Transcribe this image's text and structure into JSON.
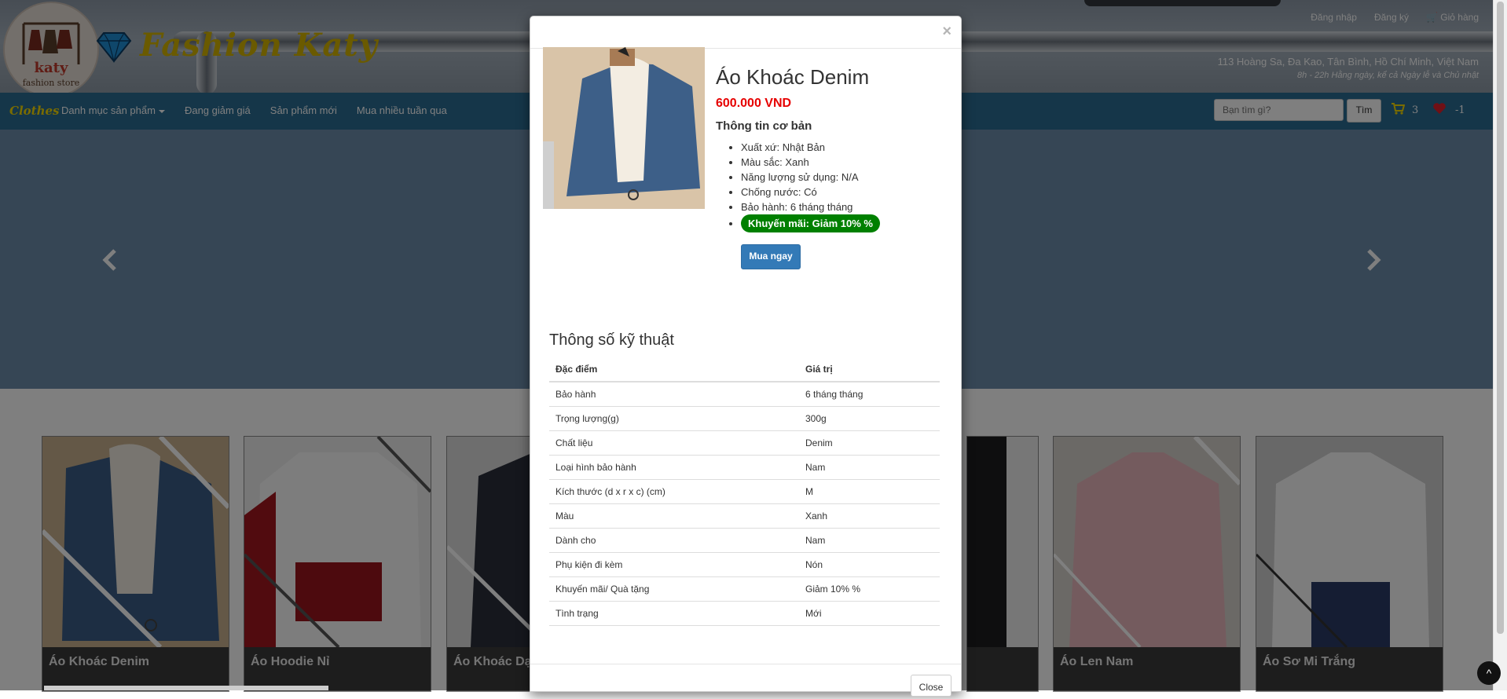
{
  "header": {
    "brand": "Fashion Katy",
    "logo_text": "katy",
    "logo_subtext": "fashion store",
    "links": [
      "Đăng nhập",
      "Đăng ký",
      "Giỏ hàng"
    ],
    "address": "113 Hoàng Sa, Đa Kao, Tân Bình, Hồ Chí Minh, Việt Nam",
    "hours": "8h - 22h Hằng ngày, kể cả Ngày lễ và Chủ nhật"
  },
  "navbar": {
    "brand": "Clothes",
    "items": [
      "Danh mục sản phẩm",
      "Đang giảm giá",
      "Sản phẩm mới",
      "Mua nhiều tuần qua"
    ],
    "search_placeholder": "Bạn tìm gì?",
    "search_button": "Tìm",
    "cart_count": "3",
    "wishlist_count": "-1"
  },
  "products": [
    {
      "name": "Áo Khoác Denim"
    },
    {
      "name": "Áo Hoodie Nỉ"
    },
    {
      "name": "Áo Khoác Dạ"
    },
    {
      "name": "Áo Len Nam"
    },
    {
      "name": "Áo Sơ Mi Trắng"
    }
  ],
  "modal": {
    "close_x": "×",
    "product_name": "Áo Khoác Denim",
    "price": "600.000 VND",
    "basic_info_title": "Thông tin cơ bản",
    "basic_info": [
      "Xuất xứ: Nhật Bản",
      "Màu sắc: Xanh",
      "Năng lượng sử dụng: N/A",
      "Chống nước: Có",
      "Bảo hành: 6 tháng tháng"
    ],
    "promo": "Khuyến mãi: Giảm 10% %",
    "buy_button": "Mua ngay",
    "spec_title": "Thông số kỹ thuật",
    "spec_headers": [
      "Đặc điểm",
      "Giá trị"
    ],
    "specs": [
      [
        "Bảo hành",
        "6 tháng tháng"
      ],
      [
        "Trọng lượng(g)",
        "300g"
      ],
      [
        "Chất liệu",
        "Denim"
      ],
      [
        "Loại hình bảo hành",
        "Nam"
      ],
      [
        "Kích thước (d x r x c) (cm)",
        "M"
      ],
      [
        "Màu",
        "Xanh"
      ],
      [
        "Dành cho",
        "Nam"
      ],
      [
        "Phụ kiện đi kèm",
        "Nón"
      ],
      [
        "Khuyến mãi/ Quà tặng",
        "Giảm 10% %"
      ],
      [
        "Tình trạng",
        "Mới"
      ]
    ],
    "close_button": "Close"
  },
  "colors": {
    "navbar": "#2a6c93",
    "price": "#e60000",
    "promo": "#008000",
    "primary_button": "#337ab7",
    "brand_yellow": "#d4b400"
  }
}
